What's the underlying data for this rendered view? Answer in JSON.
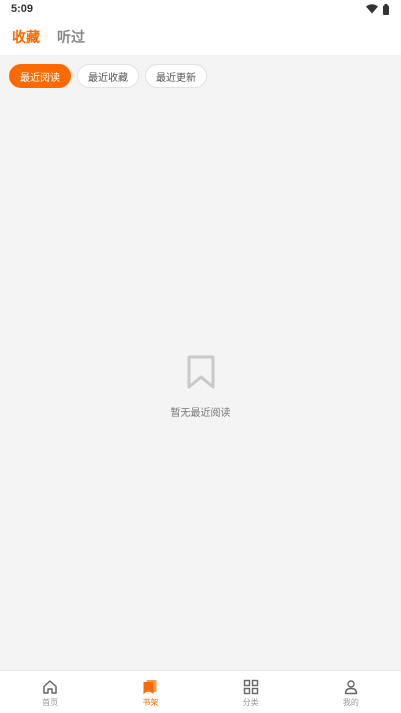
{
  "status_bar": {
    "time": "5:09"
  },
  "header": {
    "tabs": [
      {
        "label": "收藏",
        "active": true
      },
      {
        "label": "听过",
        "active": false
      }
    ]
  },
  "filters": [
    {
      "label": "最近阅读",
      "active": true
    },
    {
      "label": "最近收藏",
      "active": false
    },
    {
      "label": "最近更新",
      "active": false
    }
  ],
  "empty_state": {
    "icon": "bookmark-icon",
    "text": "暂无最近阅读"
  },
  "bottom_nav": [
    {
      "label": "首页",
      "icon": "home-icon",
      "active": false
    },
    {
      "label": "书架",
      "icon": "bookshelf-icon",
      "active": true
    },
    {
      "label": "分类",
      "icon": "grid-icon",
      "active": false
    },
    {
      "label": "我的",
      "icon": "user-icon",
      "active": false
    }
  ],
  "colors": {
    "accent": "#ff6a00",
    "background": "#f4f4f4",
    "inactive": "#999999"
  }
}
